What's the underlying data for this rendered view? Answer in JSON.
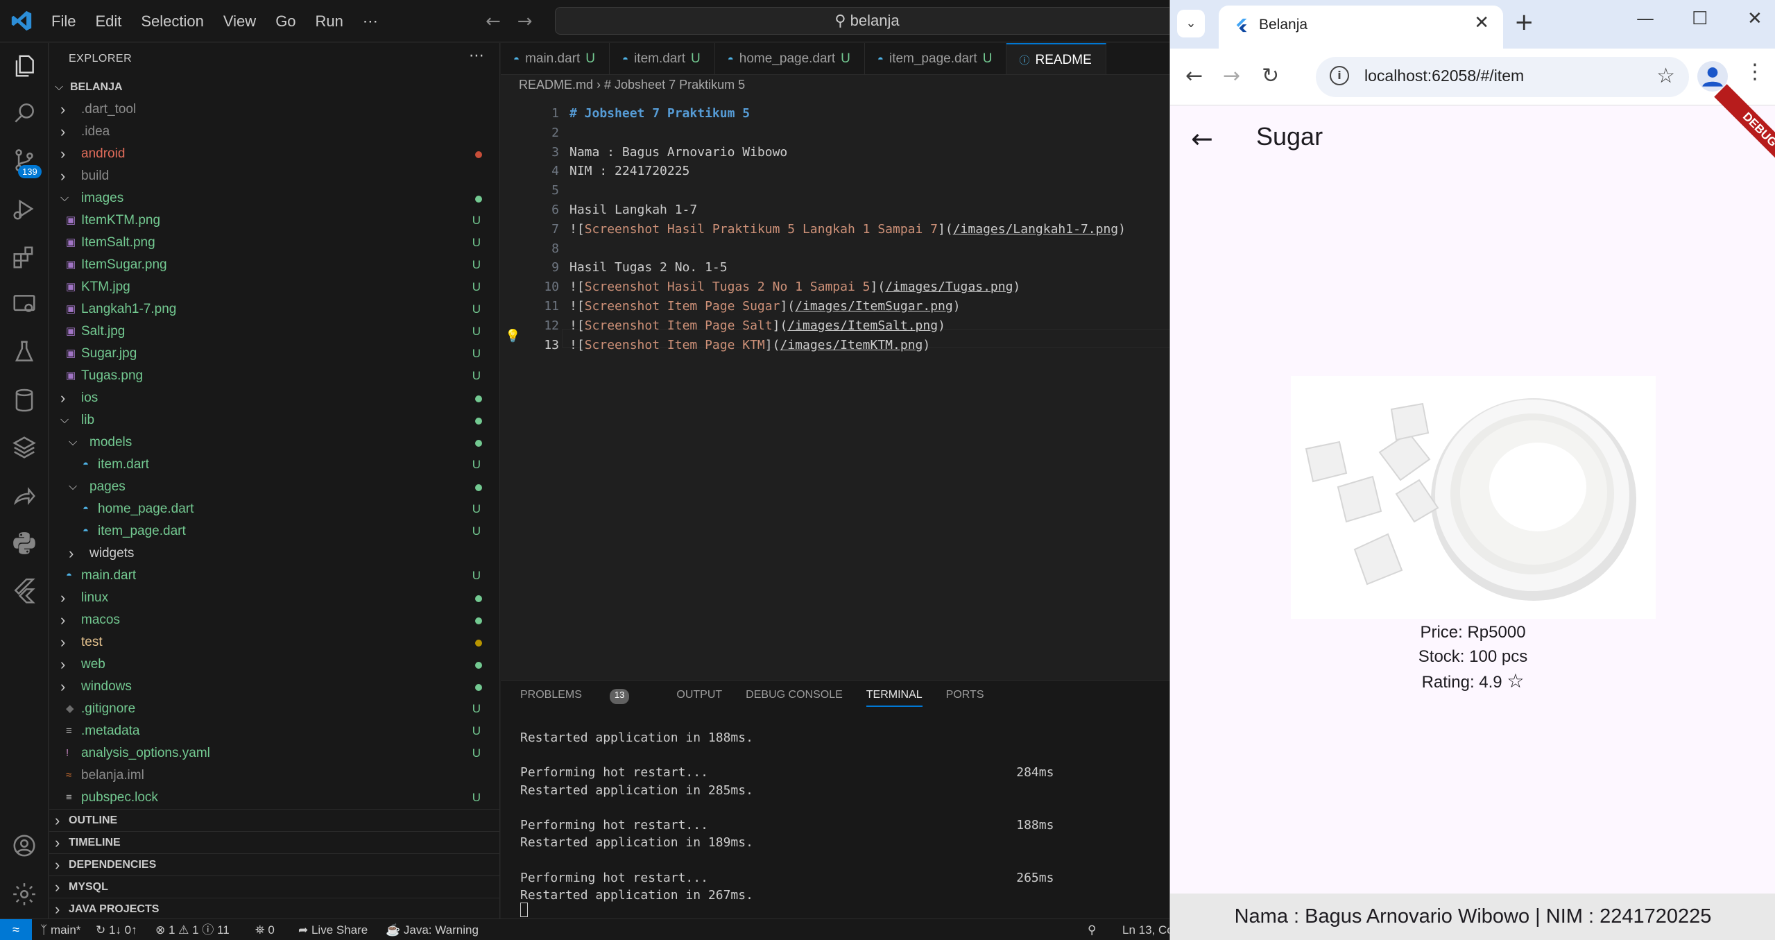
{
  "vscode": {
    "menu": [
      "File",
      "Edit",
      "Selection",
      "View",
      "Go",
      "Run",
      "⋯"
    ],
    "command_center": "belanja",
    "activity_badge": "139",
    "explorer_title": "EXPLORER",
    "tree": [
      {
        "label": "BELANJA",
        "chevron": "v",
        "kind": "root",
        "status": "",
        "color": "#ccc"
      },
      {
        "label": ".dart_tool",
        "chevron": ">",
        "kind": "folder",
        "status": "",
        "color": "#8b8b8b"
      },
      {
        "label": ".idea",
        "chevron": ">",
        "kind": "folder",
        "status": "",
        "color": "#8b8b8b"
      },
      {
        "label": "android",
        "chevron": ">",
        "kind": "folder",
        "status": "dot",
        "dotColor": "#c74e39",
        "color": "#e06c5a"
      },
      {
        "label": "build",
        "chevron": ">",
        "kind": "folder",
        "status": "",
        "color": "#8b8b8b"
      },
      {
        "label": "images",
        "chevron": "v",
        "kind": "folder",
        "status": "dot",
        "dotColor": "#73c991",
        "color": "#73c991"
      },
      {
        "label": "ItemKTM.png",
        "chevron": "",
        "kind": "image",
        "status": "U",
        "color": "#73c991"
      },
      {
        "label": "ItemSalt.png",
        "chevron": "",
        "kind": "image",
        "status": "U",
        "color": "#73c991"
      },
      {
        "label": "ItemSugar.png",
        "chevron": "",
        "kind": "image",
        "status": "U",
        "color": "#73c991"
      },
      {
        "label": "KTM.jpg",
        "chevron": "",
        "kind": "image",
        "status": "U",
        "color": "#73c991"
      },
      {
        "label": "Langkah1-7.png",
        "chevron": "",
        "kind": "image",
        "status": "U",
        "color": "#73c991"
      },
      {
        "label": "Salt.jpg",
        "chevron": "",
        "kind": "image",
        "status": "U",
        "color": "#73c991"
      },
      {
        "label": "Sugar.jpg",
        "chevron": "",
        "kind": "image",
        "status": "U",
        "color": "#73c991"
      },
      {
        "label": "Tugas.png",
        "chevron": "",
        "kind": "image",
        "status": "U",
        "color": "#73c991"
      },
      {
        "label": "ios",
        "chevron": ">",
        "kind": "folder",
        "status": "dot",
        "dotColor": "#73c991",
        "color": "#73c991"
      },
      {
        "label": "lib",
        "chevron": "v",
        "kind": "folder",
        "status": "dot",
        "dotColor": "#73c991",
        "color": "#73c991"
      },
      {
        "label": "models",
        "chevron": "v",
        "kind": "folder",
        "status": "dot",
        "dotColor": "#73c991",
        "color": "#73c991",
        "indent": 1
      },
      {
        "label": "item.dart",
        "chevron": "",
        "kind": "dart",
        "status": "U",
        "color": "#73c991",
        "indent": 2
      },
      {
        "label": "pages",
        "chevron": "v",
        "kind": "folder",
        "status": "dot",
        "dotColor": "#73c991",
        "color": "#73c991",
        "indent": 1
      },
      {
        "label": "home_page.dart",
        "chevron": "",
        "kind": "dart",
        "status": "U",
        "color": "#73c991",
        "indent": 2
      },
      {
        "label": "item_page.dart",
        "chevron": "",
        "kind": "dart",
        "status": "U",
        "color": "#73c991",
        "indent": 2
      },
      {
        "label": "widgets",
        "chevron": ">",
        "kind": "folder",
        "status": "",
        "color": "#ccc",
        "indent": 1
      },
      {
        "label": "main.dart",
        "chevron": "",
        "kind": "dart",
        "status": "U",
        "color": "#73c991"
      },
      {
        "label": "linux",
        "chevron": ">",
        "kind": "folder",
        "status": "dot",
        "dotColor": "#73c991",
        "color": "#73c991"
      },
      {
        "label": "macos",
        "chevron": ">",
        "kind": "folder",
        "status": "dot",
        "dotColor": "#73c991",
        "color": "#73c991"
      },
      {
        "label": "test",
        "chevron": ">",
        "kind": "folder",
        "status": "dot",
        "dotColor": "#b89500",
        "color": "#e2c08d"
      },
      {
        "label": "web",
        "chevron": ">",
        "kind": "folder",
        "status": "dot",
        "dotColor": "#73c991",
        "color": "#73c991"
      },
      {
        "label": "windows",
        "chevron": ">",
        "kind": "folder",
        "status": "dot",
        "dotColor": "#73c991",
        "color": "#73c991"
      },
      {
        "label": ".gitignore",
        "chevron": "",
        "kind": "git",
        "status": "U",
        "color": "#73c991"
      },
      {
        "label": ".metadata",
        "chevron": "",
        "kind": "lines",
        "status": "U",
        "color": "#73c991"
      },
      {
        "label": "analysis_options.yaml",
        "chevron": "",
        "kind": "yaml",
        "status": "U",
        "color": "#73c991"
      },
      {
        "label": "belanja.iml",
        "chevron": "",
        "kind": "rss",
        "status": "",
        "color": "#8b8b8b"
      },
      {
        "label": "pubspec.lock",
        "chevron": "",
        "kind": "lines",
        "status": "U",
        "color": "#73c991"
      }
    ],
    "sections": [
      "OUTLINE",
      "TIMELINE",
      "DEPENDENCIES",
      "MYSQL",
      "JAVA PROJECTS"
    ],
    "tabs": [
      {
        "label": "main.dart",
        "mark": "U",
        "active": false
      },
      {
        "label": "item.dart",
        "mark": "U",
        "active": false
      },
      {
        "label": "home_page.dart",
        "mark": "U",
        "active": false
      },
      {
        "label": "item_page.dart",
        "mark": "U",
        "active": false
      },
      {
        "label": "README",
        "mark": "",
        "active": true
      }
    ],
    "breadcrumb": "README.md › # Jobsheet 7 Praktikum 5",
    "code_lines": [
      {
        "n": "1",
        "text": "# Jobsheet 7 Praktikum 5",
        "type": "heading"
      },
      {
        "n": "2",
        "text": "",
        "type": "plain"
      },
      {
        "n": "3",
        "text": "Nama : Bagus Arnovario Wibowo",
        "type": "plain"
      },
      {
        "n": "4",
        "text": "NIM : 2241720225",
        "type": "plain"
      },
      {
        "n": "5",
        "text": "",
        "type": "plain"
      },
      {
        "n": "6",
        "text": "Hasil Langkah 1-7",
        "type": "plain"
      },
      {
        "n": "7",
        "alt": "Screenshot Hasil Praktikum 5 Langkah 1 Sampai 7",
        "url": "/images/Langkah1-7.png",
        "type": "img"
      },
      {
        "n": "8",
        "text": "",
        "type": "plain"
      },
      {
        "n": "9",
        "text": "Hasil Tugas 2 No. 1-5",
        "type": "plain"
      },
      {
        "n": "10",
        "alt": "Screenshot Hasil Tugas 2 No 1 Sampai 5",
        "url": "/images/Tugas.png",
        "type": "img"
      },
      {
        "n": "11",
        "alt": "Screenshot Item Page Sugar",
        "url": "/images/ItemSugar.png",
        "type": "img"
      },
      {
        "n": "12",
        "alt": "Screenshot Item Page Salt",
        "url": "/images/ItemSalt.png",
        "type": "img"
      },
      {
        "n": "13",
        "alt": "Screenshot Item Page KTM",
        "url": "/images/ItemKTM.png",
        "type": "img"
      }
    ],
    "panel_tabs": {
      "problems": "PROBLEMS",
      "problems_count": "13",
      "output": "OUTPUT",
      "debug": "DEBUG CONSOLE",
      "terminal": "TERMINAL",
      "ports": "PORTS"
    },
    "terminal_lines": [
      "Restarted application in 188ms.",
      "",
      "Performing hot restart...                                         284ms",
      "Restarted application in 285ms.",
      "",
      "Performing hot restart...                                         188ms",
      "Restarted application in 189ms.",
      "",
      "Performing hot restart...                                         265ms",
      "Restarted application in 267ms."
    ],
    "status": {
      "branch": "main*",
      "sync": "↻ 1↓ 0↑",
      "problems": "⊗ 1 ⚠ 1 ⓘ 11",
      "ports": "⛯ 0",
      "liveshare": "Live Share",
      "java": "Java: Warning",
      "position": "Ln 13, Co"
    }
  },
  "browser": {
    "tab_title": "Belanja",
    "url": "localhost:62058/#/item",
    "app": {
      "title": "Sugar",
      "debug_banner": "DEBUG",
      "price": "Price: Rp5000",
      "stock": "Stock: 100 pcs",
      "rating": "Rating: 4.9",
      "footer": "Nama : Bagus Arnovario Wibowo | NIM : 2241720225"
    }
  }
}
